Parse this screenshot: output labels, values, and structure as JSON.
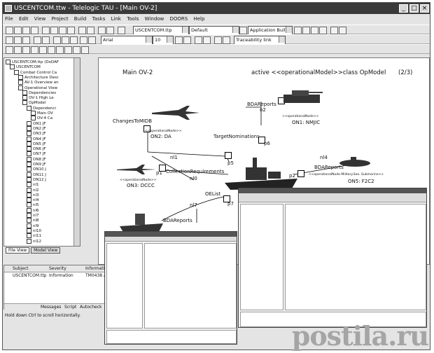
{
  "window": {
    "title": "USCENTCOM.ttw - Telelogic TAU - [Main OV-2]"
  },
  "menu": [
    "File",
    "Edit",
    "View",
    "Project",
    "Build",
    "Tasks",
    "Link",
    "Tools",
    "Window",
    "DOORS",
    "Help"
  ],
  "toolbar": {
    "project_combo": "USCENTCOM.ttp",
    "config_combo": "Default",
    "builder_combo": "Application Builder",
    "font_combo": "Arial",
    "size_combo": "10",
    "link_combo": "Traceability link"
  },
  "tree": {
    "items": [
      "USCENTCOM.ttp (DoDAF",
      "USCENTCOM",
      "Combat Control Ca",
      "Architecture Desc",
      "AV-1 Overview an",
      "Operational View",
      "Dependencies",
      "OV-1 High Le",
      "OpModel",
      "Dependenci",
      "Main OV",
      "OV-4 Ca",
      "ON1 JF",
      "ON2 JF",
      "ON3 JF",
      "ON4 JF",
      "ON5 JF",
      "ON6 JF",
      "ON7 JF",
      "ON8 JF",
      "ON9 JF",
      "ON10 J",
      "ON11 J",
      "ON12 J",
      "nl1",
      "nl2",
      "nl3",
      "nl4",
      "nl5",
      "nl6",
      "nl7",
      "nl8",
      "nl9",
      "nl10",
      "nl11",
      "nl12"
    ],
    "tabs": [
      "File View",
      "Model View"
    ]
  },
  "diagram": {
    "title": "Main OV-2",
    "header": "active <<operationalModel>>class OpModel",
    "page": "(2/3)",
    "labels": {
      "changes": "ChangesToMIDB",
      "on2": "ON2: DA",
      "on2_stereo": "<<operationalNode>>",
      "bdareports_top": "BDAReports",
      "n2": "n2",
      "on1_stereo": "<<operationalNode>>",
      "on1": "ON1: NMJIC",
      "target": "TargetNominations",
      "p6": "p6",
      "nl1": "nl1",
      "p5": "p5",
      "nl4": "nl4",
      "collection": "CollectionRequirements",
      "nl0": "nl0",
      "p1": "p1",
      "p2": "p2",
      "bdareports_right": "BDAReports",
      "on5_stereo": "<<operationalNode.Military.Sea..Submarine>>",
      "on5": "ON5: F2C2",
      "on3_stereo": "<<operationalNode>>",
      "on3": "ON3: DCCC",
      "oelist": "OEList",
      "p7": "p7",
      "nl7": "nl7",
      "bdareports_bottom": "BDAReports"
    }
  },
  "bottom_panel": {
    "headers": [
      "Subject",
      "Severity",
      "Information"
    ],
    "row": {
      "subject": "USCENTCOM.ttp",
      "severity": "Information",
      "info": "TM0438 Al"
    },
    "tabs": [
      "Messages",
      "Script",
      "Autocheck"
    ]
  },
  "status_bar": "Hold down Ctrl to scroll horizontally.",
  "watermark": "postila.ru"
}
